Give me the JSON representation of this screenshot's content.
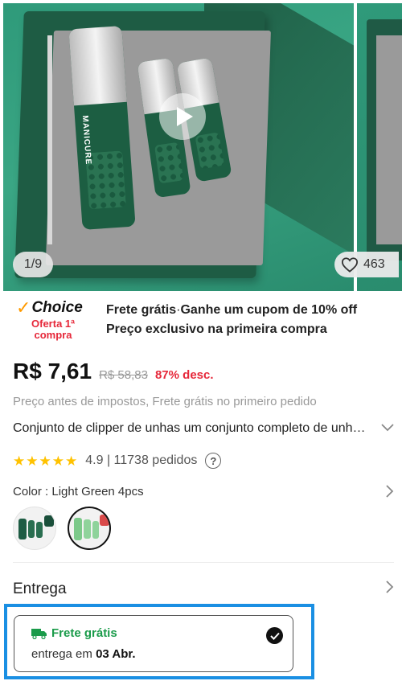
{
  "gallery": {
    "counter": "1/9",
    "likes": "463",
    "clipper_label": "MANICURE",
    "icons": {
      "play": "play-icon",
      "like": "heart-icon"
    }
  },
  "choice": {
    "brand": "Choice",
    "sub": "Oferta 1ª compra",
    "line1_a": "Frete grátis",
    "line1_sep": "·",
    "line1_b": "Ganhe um cupom de 10% off",
    "line2": "Preço exclusivo na primeira compra"
  },
  "price": {
    "current": "R$ 7,61",
    "old": "R$ 58,83",
    "discount": "87% desc."
  },
  "tax_note": "Preço antes de impostos, Frete grátis no primeiro pedido",
  "product": {
    "title": "Conjunto de clipper de unhas um conjunto completo de unhas de aço inoxidável"
  },
  "rating": {
    "score_text": "4.9 | 11738 pedidos",
    "stars": 5
  },
  "color": {
    "label": "Color",
    "value": "Light Green 4pcs"
  },
  "delivery": {
    "title": "Entrega",
    "option_title": "Frete grátis",
    "date_prefix": "entrega em",
    "date": "03 Abr."
  },
  "colors": {
    "accent_red": "#e6283a",
    "choice_orange": "#ff9a00",
    "shipping_green": "#1a9b4a",
    "focus_blue": "#1a8fe3",
    "star_yellow": "#ffc200"
  }
}
